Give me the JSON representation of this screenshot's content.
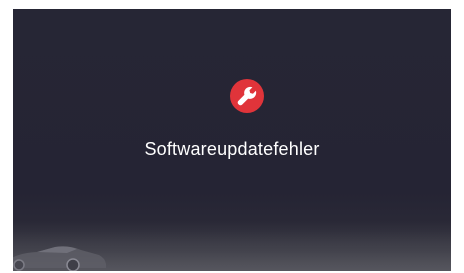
{
  "screen": {
    "message": "Softwareupdatefehler",
    "icon": "wrench-icon",
    "icon_color": "#e0343a",
    "background_color": "#262635"
  }
}
